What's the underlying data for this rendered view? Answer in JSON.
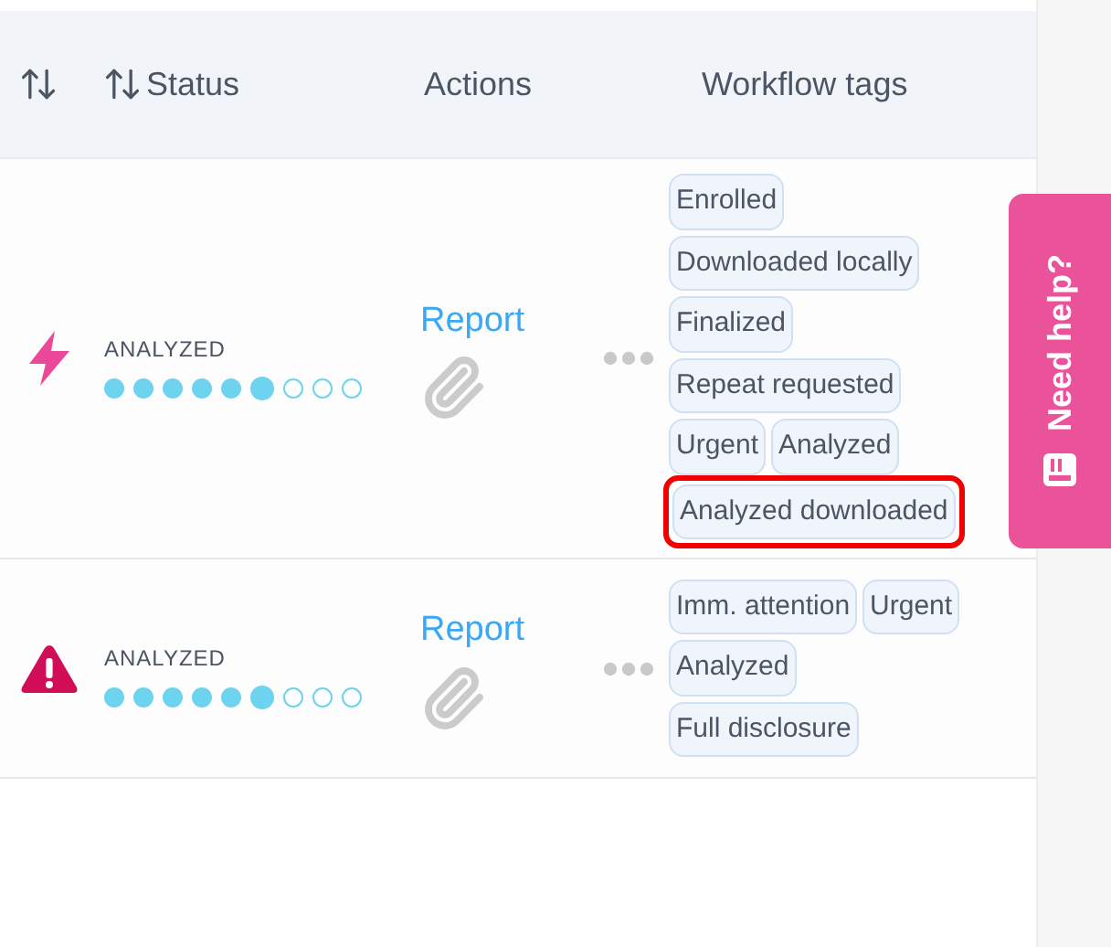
{
  "header": {
    "columns": [
      {
        "sortable": true
      },
      {
        "label": "Status",
        "sortable": true
      },
      {
        "label": "Actions",
        "sortable": false
      },
      {
        "label": "Workflow tags",
        "sortable": false
      }
    ]
  },
  "rows": [
    {
      "kind": "lightning",
      "status": "ANALYZED",
      "steps": [
        {
          "kind": "done"
        },
        {
          "kind": "done"
        },
        {
          "kind": "done"
        },
        {
          "kind": "done"
        },
        {
          "kind": "done"
        },
        {
          "kind": "current"
        },
        {
          "kind": "pending"
        },
        {
          "kind": "pending"
        },
        {
          "kind": "pending"
        }
      ],
      "action": "Report",
      "tags": [
        {
          "label": "Enrolled",
          "highlighted": false
        },
        {
          "label": "Downloaded locally",
          "highlighted": false
        },
        {
          "label": "Finalized",
          "highlighted": false
        },
        {
          "label": "Repeat requested",
          "highlighted": false
        },
        {
          "label": "Urgent",
          "highlighted": false
        },
        {
          "label": "Analyzed",
          "highlighted": false
        },
        {
          "label": "Analyzed downloaded",
          "highlighted": true
        }
      ]
    },
    {
      "kind": "warning",
      "status": "ANALYZED",
      "steps": [
        {
          "kind": "done"
        },
        {
          "kind": "done"
        },
        {
          "kind": "done"
        },
        {
          "kind": "done"
        },
        {
          "kind": "done"
        },
        {
          "kind": "current"
        },
        {
          "kind": "pending"
        },
        {
          "kind": "pending"
        },
        {
          "kind": "pending"
        }
      ],
      "action": "Report",
      "tags": [
        {
          "label": "Imm. attention",
          "highlighted": false
        },
        {
          "label": "Urgent",
          "highlighted": false
        },
        {
          "label": "Analyzed",
          "highlighted": false
        },
        {
          "label": "Full disclosure",
          "highlighted": false
        }
      ]
    }
  ],
  "help_tab": {
    "label": "Need help?"
  }
}
